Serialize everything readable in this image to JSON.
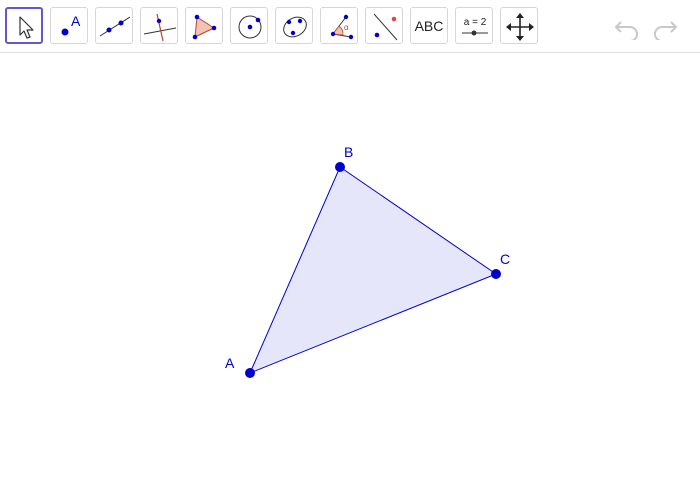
{
  "toolbar": {
    "tools": [
      {
        "name": "Move",
        "icon": "move-arrow-icon",
        "selected": true
      },
      {
        "name": "Point",
        "icon": "point-icon",
        "label": "A"
      },
      {
        "name": "Line",
        "icon": "line-icon"
      },
      {
        "name": "Perpendicular Line",
        "icon": "perpendicular-line-icon"
      },
      {
        "name": "Polygon",
        "icon": "polygon-icon"
      },
      {
        "name": "Circle with Center through Point",
        "icon": "circle-icon"
      },
      {
        "name": "Ellipse",
        "icon": "ellipse-icon"
      },
      {
        "name": "Angle",
        "icon": "angle-icon"
      },
      {
        "name": "Reflect about Line",
        "icon": "reflect-icon"
      },
      {
        "name": "Text",
        "icon": "text-icon",
        "label": "ABC"
      },
      {
        "name": "Slider",
        "icon": "slider-icon",
        "label": "a = 2"
      },
      {
        "name": "Move Graphics View",
        "icon": "move-view-icon"
      }
    ],
    "undo_icon": "undo-icon",
    "redo_icon": "redo-icon"
  },
  "construction": {
    "points": [
      {
        "label": "A"
      },
      {
        "label": "B"
      },
      {
        "label": "C"
      }
    ],
    "polygon": "triangle ABC",
    "colors": {
      "point_fill": "#0000cc",
      "edge": "#0000cc",
      "fill": "#e6e6fa",
      "selected_tool_border": "#6557d2"
    }
  }
}
